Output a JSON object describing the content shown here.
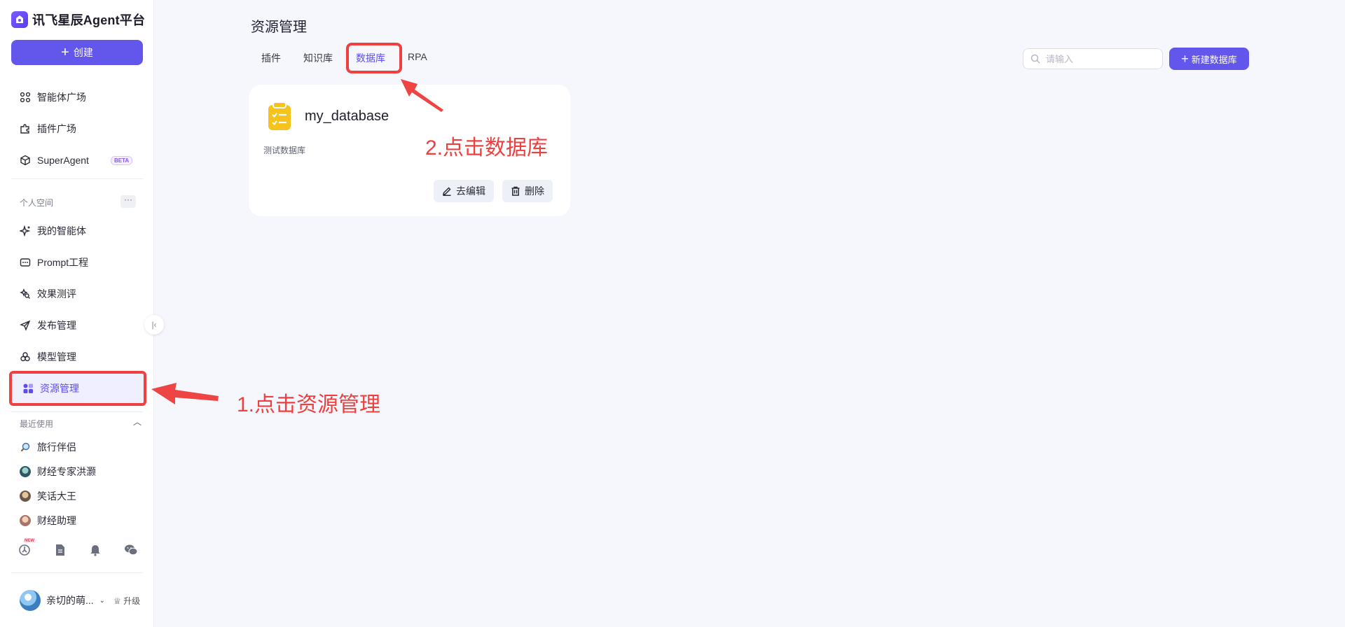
{
  "app": {
    "logo_text": "讯飞星辰Agent平台",
    "create_label": "创建"
  },
  "sidebar": {
    "top_items": [
      {
        "label": "智能体广场",
        "icon": "grid-icon"
      },
      {
        "label": "插件广场",
        "icon": "puzzle-icon"
      },
      {
        "label": "SuperAgent",
        "icon": "cube-icon",
        "badge": "BETA"
      }
    ],
    "personal_label": "个人空间",
    "more_label": "···",
    "personal_items": [
      {
        "label": "我的智能体",
        "icon": "sparkle-icon"
      },
      {
        "label": "Prompt工程",
        "icon": "prompt-icon"
      },
      {
        "label": "效果测评",
        "icon": "evaluate-icon"
      },
      {
        "label": "发布管理",
        "icon": "send-icon"
      },
      {
        "label": "模型管理",
        "icon": "model-icon"
      },
      {
        "label": "资源管理",
        "icon": "resource-icon",
        "active": true
      }
    ],
    "recent_label": "最近使用",
    "recent_items": [
      {
        "label": "旅行伴侣"
      },
      {
        "label": "财经专家洪灏"
      },
      {
        "label": "笑话大王"
      },
      {
        "label": "财经助理"
      }
    ],
    "bottom_icons": [
      "community-icon",
      "document-icon",
      "bell-icon",
      "wechat-icon"
    ],
    "new_tag": "NEW",
    "user_name": "亲切的萌...",
    "upgrade_label": "升级"
  },
  "main": {
    "title": "资源管理",
    "tabs": [
      {
        "label": "插件"
      },
      {
        "label": "知识库"
      },
      {
        "label": "数据库",
        "active": true
      },
      {
        "label": "RPA"
      }
    ],
    "search_placeholder": "请输入",
    "new_button_label": "新建数据库",
    "cards": [
      {
        "name": "my_database",
        "description": "测试数据库",
        "edit_label": "去编辑",
        "delete_label": "删除"
      }
    ]
  },
  "annotations": {
    "step1": "1.点击资源管理",
    "step2": "2.点击数据库"
  },
  "colors": {
    "accent": "#6356ea",
    "annotation_red": "#ef3f3f",
    "card_icon_yellow": "#f6c21c"
  }
}
